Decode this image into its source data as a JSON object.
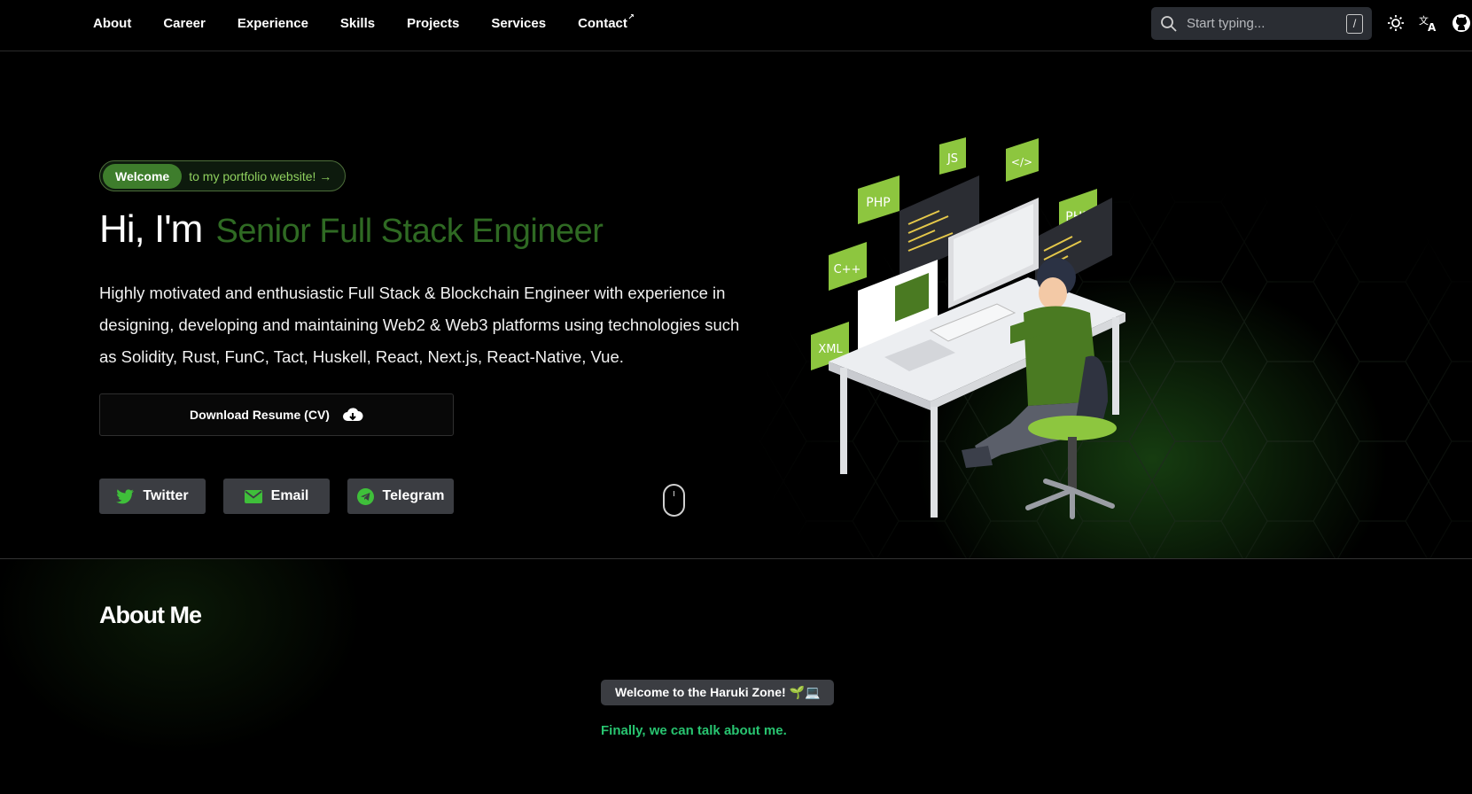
{
  "nav": {
    "links": [
      "About",
      "Career",
      "Experience",
      "Skills",
      "Projects",
      "Services",
      "Contact"
    ],
    "contact_external_icon": "external-arrow-icon",
    "search": {
      "placeholder": "Start typing...",
      "shortcut": "/"
    },
    "icons": [
      "theme-sun-icon",
      "translate-icon",
      "github-icon"
    ]
  },
  "hero": {
    "welcome_badge": "Welcome",
    "welcome_text": "to my portfolio website! →",
    "greeting": "Hi, I'm",
    "role": "Senior Full Stack Engineer",
    "description": "Highly motivated and enthusiastic Full Stack & Blockchain Engineer with experience in designing, developing and maintaining Web2 & Web3 platforms using technologies such as Solidity, Rust, FunC, Tact, Huskell, React, Next.js, React-Native, Vue.",
    "cv_button": "Download Resume (CV)",
    "socials": [
      {
        "label": "Twitter",
        "icon": "twitter-icon"
      },
      {
        "label": "Email",
        "icon": "email-icon"
      },
      {
        "label": "Telegram",
        "icon": "telegram-icon"
      }
    ],
    "illustration_tags": [
      "JS",
      "</>",
      "PHP",
      "PHP",
      "C++",
      "XML"
    ]
  },
  "about": {
    "title": "About Me",
    "badge": "Welcome to the Haruki Zone! 🌱💻",
    "subtitle": "Finally, we can talk about me."
  },
  "colors": {
    "accent_green": "#3e7d2c",
    "role_green": "#2f6a23",
    "light_green": "#8fd05e",
    "subtitle_green": "#28c470",
    "button_gray": "#3b3d42"
  }
}
